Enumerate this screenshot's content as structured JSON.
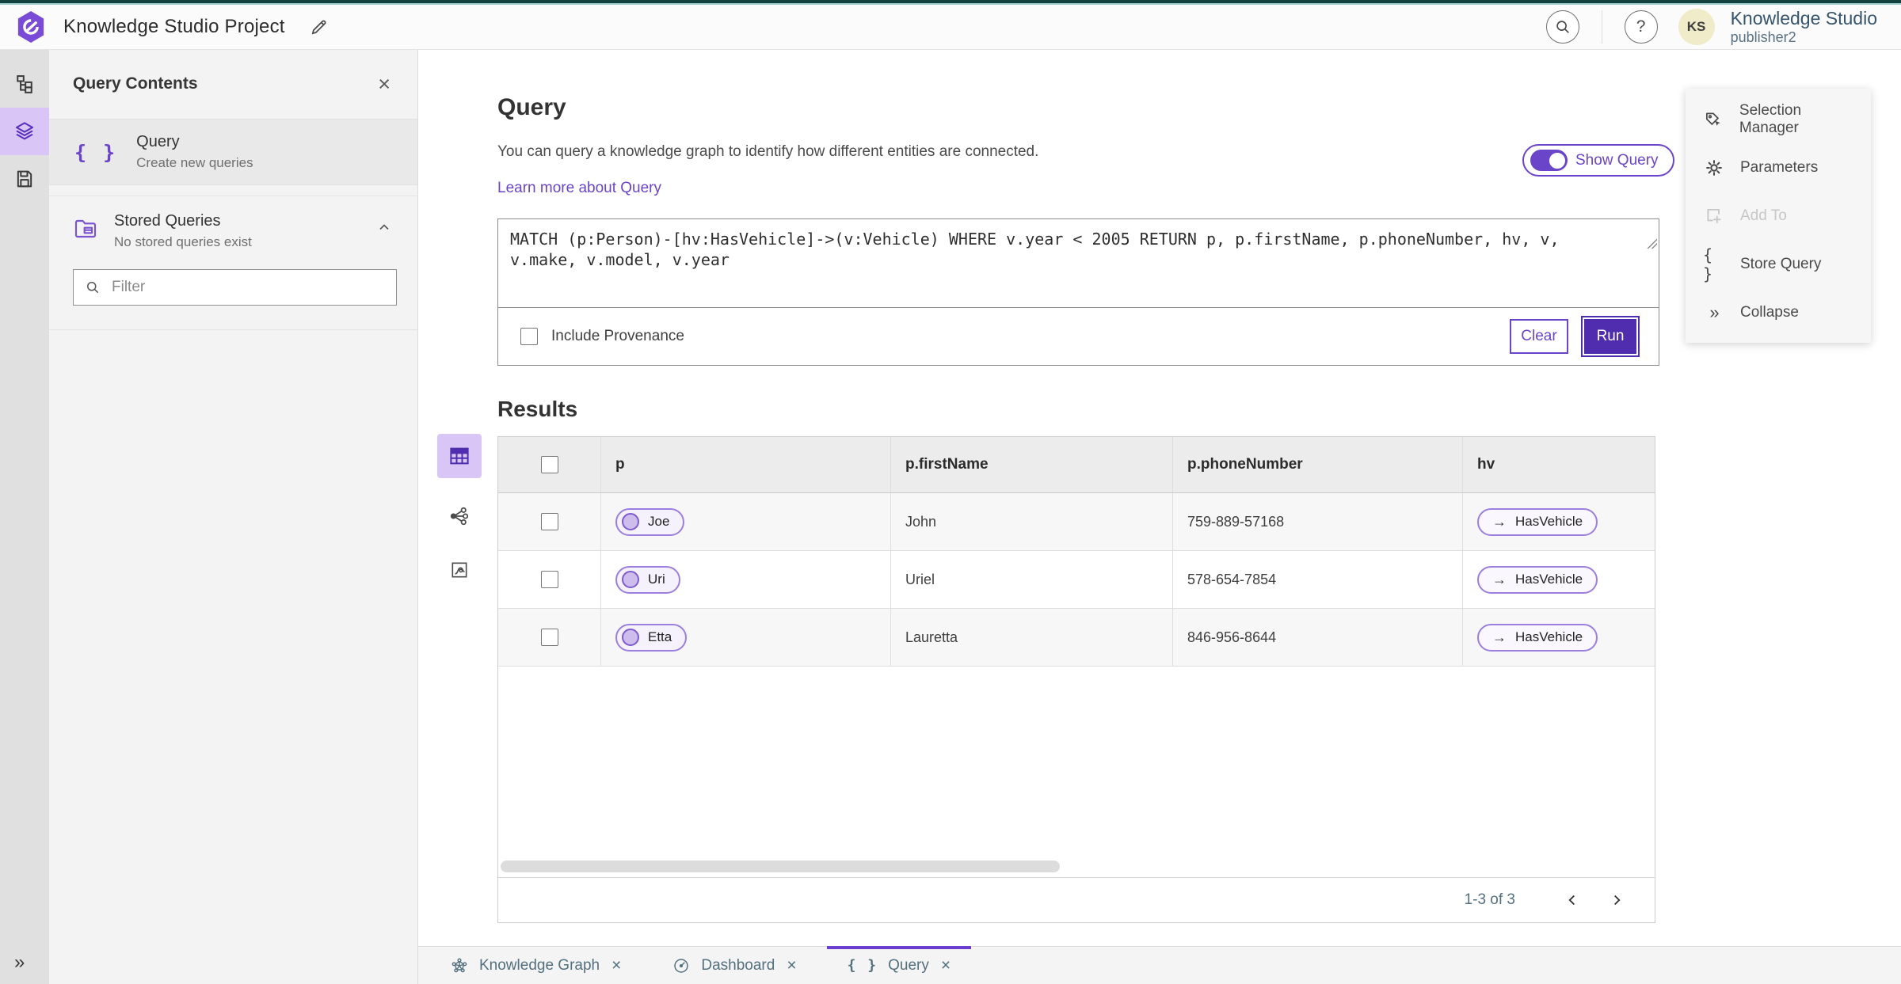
{
  "colors": {
    "accent_purple": "#6a44c9",
    "run_button_purple": "#4f2dae",
    "active_item_purple_bg": "#d9c6f6",
    "topbar_teal_dark": "#14403f",
    "topbar_teal_light": "#9ecfcf",
    "slate_text": "#53707f",
    "avatar_bg": "#f0ecca"
  },
  "icons": {
    "braces_glyph": "{ }",
    "collapse_glyph": "»",
    "expand_glyph": "»",
    "close_glyph": "×",
    "help_glyph": "?"
  },
  "header": {
    "title": "Knowledge Studio Project",
    "avatar_initials": "KS",
    "user_org": "Knowledge Studio",
    "user_name": "publisher2"
  },
  "contents_panel": {
    "title": "Query Contents",
    "query_item": {
      "title": "Query",
      "subtitle": "Create new queries"
    },
    "stored_queries": {
      "title": "Stored Queries",
      "subtitle": "No stored queries exist"
    },
    "filter_placeholder": "Filter"
  },
  "query_section": {
    "heading": "Query",
    "description": "You can query a knowledge graph to identify how different entities are connected.",
    "learn_more_label": "Learn more about Query",
    "show_query_label": "Show Query",
    "query_text": "MATCH (p:Person)-[hv:HasVehicle]->(v:Vehicle) WHERE v.year < 2005 RETURN p, p.firstName, p.phoneNumber, hv, v, v.make, v.model, v.year",
    "include_provenance_label": "Include Provenance",
    "clear_button_label": "Clear",
    "run_button_label": "Run"
  },
  "results": {
    "heading": "Results",
    "columns": [
      "p",
      "p.firstName",
      "p.phoneNumber",
      "hv"
    ],
    "edge_arrow": "→",
    "rows": [
      {
        "p_node": "Joe",
        "first_name": "John",
        "phone_number": "759-889-57168",
        "hv_edge": "HasVehicle"
      },
      {
        "p_node": "Uri",
        "first_name": "Uriel",
        "phone_number": "578-654-7854",
        "hv_edge": "HasVehicle"
      },
      {
        "p_node": "Etta",
        "first_name": "Lauretta",
        "phone_number": "846-956-8644",
        "hv_edge": "HasVehicle"
      }
    ],
    "pagination_label": "1-3 of 3"
  },
  "tools_panel": {
    "items": [
      {
        "label": "Selection Manager",
        "disabled": false
      },
      {
        "label": "Parameters",
        "disabled": false
      },
      {
        "label": "Add To",
        "disabled": true
      },
      {
        "label": "Store Query",
        "disabled": false
      },
      {
        "label": "Collapse",
        "disabled": false
      }
    ]
  },
  "bottom_tabs": [
    {
      "label": "Knowledge Graph",
      "active": false
    },
    {
      "label": "Dashboard",
      "active": false
    },
    {
      "label": "Query",
      "active": true
    }
  ]
}
